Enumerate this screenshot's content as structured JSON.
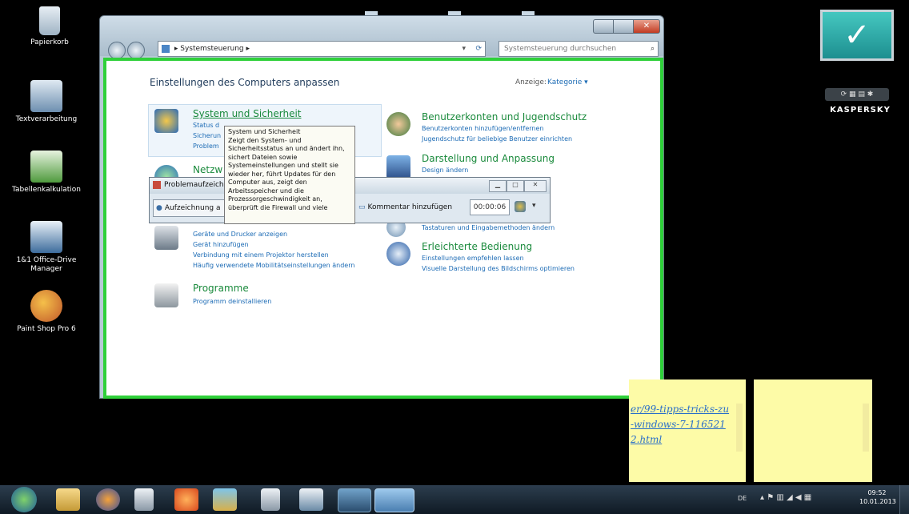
{
  "desktop": {
    "icons": [
      {
        "label": "Papierkorb"
      },
      {
        "label": "Textverarbeitung"
      },
      {
        "label": "Tabellenkalkulation"
      },
      {
        "label": "1&1 Office-Drive Manager"
      },
      {
        "label": "Paint Shop Pro 6"
      }
    ]
  },
  "window": {
    "breadcrumb": "Systemsteuerung",
    "search_placeholder": "Systemsteuerung durchsuchen",
    "title": "Einstellungen des Computers anpassen",
    "view_label": "Anzeige:",
    "view_value": "Kategorie"
  },
  "categories": {
    "system": {
      "title": "System und Sicherheit",
      "links": [
        "Status d",
        "Sicherun",
        "Problem"
      ]
    },
    "network": {
      "title": "Netzw"
    },
    "hardware": {
      "links": [
        "Geräte und Drucker anzeigen",
        "Gerät hinzufügen",
        "Verbindung mit einem Projektor herstellen",
        "Häufig verwendete Mobilitätseinstellungen ändern"
      ]
    },
    "programs": {
      "title": "Programme",
      "links": [
        "Programm deinstallieren"
      ]
    },
    "users": {
      "title": "Benutzerkonten und Jugendschutz",
      "links": [
        "Benutzerkonten hinzufügen/entfernen",
        "Jugendschutz für beliebige Benutzer einrichten"
      ]
    },
    "appearance": {
      "title": "Darstellung und Anpassung",
      "links": [
        "Design ändern"
      ]
    },
    "region": {
      "links": [
        "Tastaturen und Eingabemethoden ändern"
      ]
    },
    "ease": {
      "title": "Erleichterte Bedienung",
      "links": [
        "Einstellungen empfehlen lassen",
        "Visuelle Darstellung des Bildschirms optimieren"
      ]
    }
  },
  "tooltip": {
    "title": "System und Sicherheit",
    "text": "Zeigt den System- und Sicherheitsstatus an und ändert ihn, sichert Dateien sowie Systemeinstellungen und stellt sie wieder her, führt Updates für den Computer aus, zeigt den Arbeitsspeicher und die Prozessorgeschwindigkeit an, überprüft die Firewall und viele"
  },
  "psr": {
    "title": "Problemaufzeich",
    "record_label": "Aufzeichnung a",
    "comment_label": "Kommentar hinzufügen",
    "timer": "00:00:06"
  },
  "kaspersky": {
    "brand": "KASPERSKY"
  },
  "note": {
    "text": "er/99-tipps-tricks-zu-windows-7-1165212.html"
  },
  "taskbar": {
    "lang": "DE",
    "time": "09:52",
    "date": "10.01.2013"
  },
  "colors": {
    "accent_green": "#2fd03a",
    "link_blue": "#1c6bb5",
    "heading_green": "#1a8a3c",
    "note_yellow": "#fdfba7"
  }
}
